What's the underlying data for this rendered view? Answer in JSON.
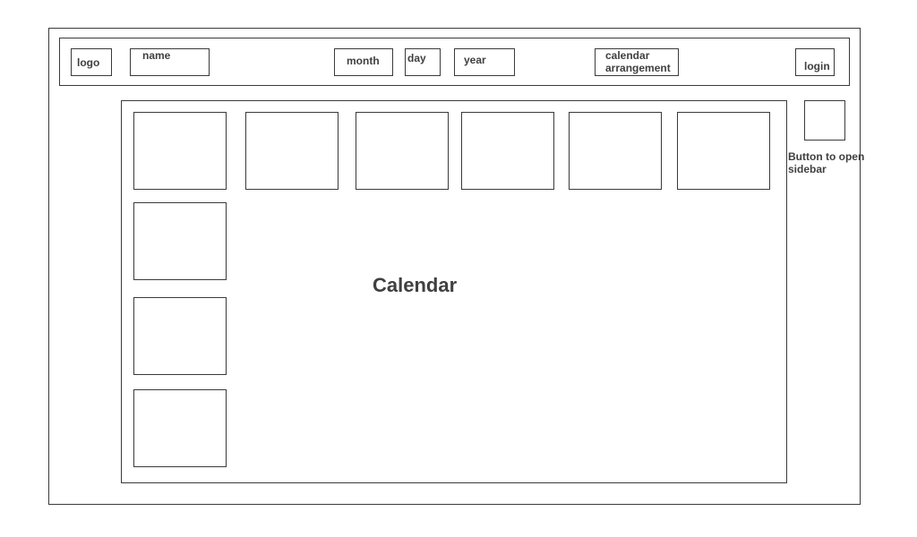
{
  "header": {
    "logo": "logo",
    "name": "name",
    "month": "month",
    "day": "day",
    "year": "year",
    "calendar_arrangement": "calendar arrangement",
    "login": "login"
  },
  "calendar": {
    "title": "Calendar"
  },
  "sidebar_button": {
    "caption": "Button to open sidebar"
  }
}
